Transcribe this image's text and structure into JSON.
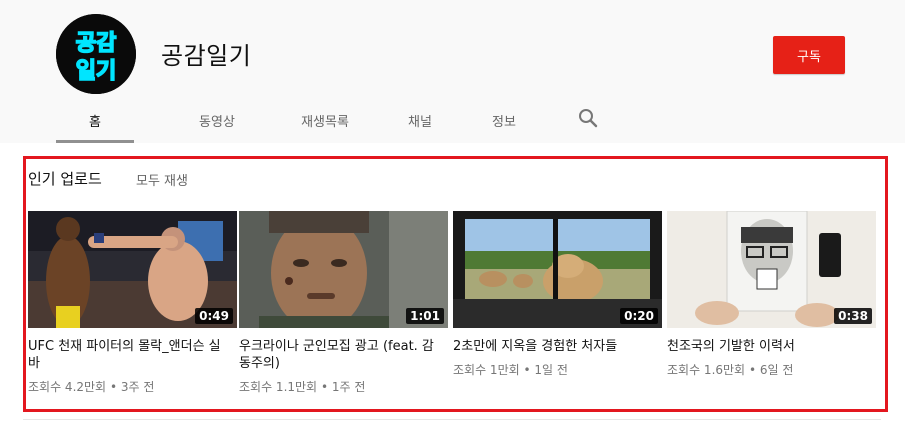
{
  "channel": {
    "name": "공감일기",
    "avatar_text_line1": "공감",
    "avatar_text_line2": "일기",
    "subscribe_label": "구독",
    "accent_color": "#e62117",
    "avatar_glow_color": "#00e5ff"
  },
  "tabs": [
    {
      "label": "홈",
      "active": true
    },
    {
      "label": "동영상",
      "active": false
    },
    {
      "label": "재생목록",
      "active": false
    },
    {
      "label": "채널",
      "active": false
    },
    {
      "label": "정보",
      "active": false
    }
  ],
  "search_icon": "search-icon",
  "shelf": {
    "title": "인기 업로드",
    "play_all_label": "모두 재생",
    "highlight_color": "#e3171f"
  },
  "videos": [
    {
      "title": "UFC 천재 파이터의 몰락_앤더슨 실바",
      "duration": "0:49",
      "views": "조회수 4.2만회",
      "age": "3주 전"
    },
    {
      "title": "우크라이나 군인모집 광고 (feat. 감동주의)",
      "duration": "1:01",
      "views": "조회수 1.1만회",
      "age": "1주 전"
    },
    {
      "title": "2초만에 지옥을 경험한 처자들",
      "duration": "0:20",
      "views": "조회수 1만회",
      "age": "1일 전"
    },
    {
      "title": "천조국의 기발한 이력서",
      "duration": "0:38",
      "views": "조회수 1.6만회",
      "age": "6일 전"
    }
  ],
  "meta_separator": "•"
}
